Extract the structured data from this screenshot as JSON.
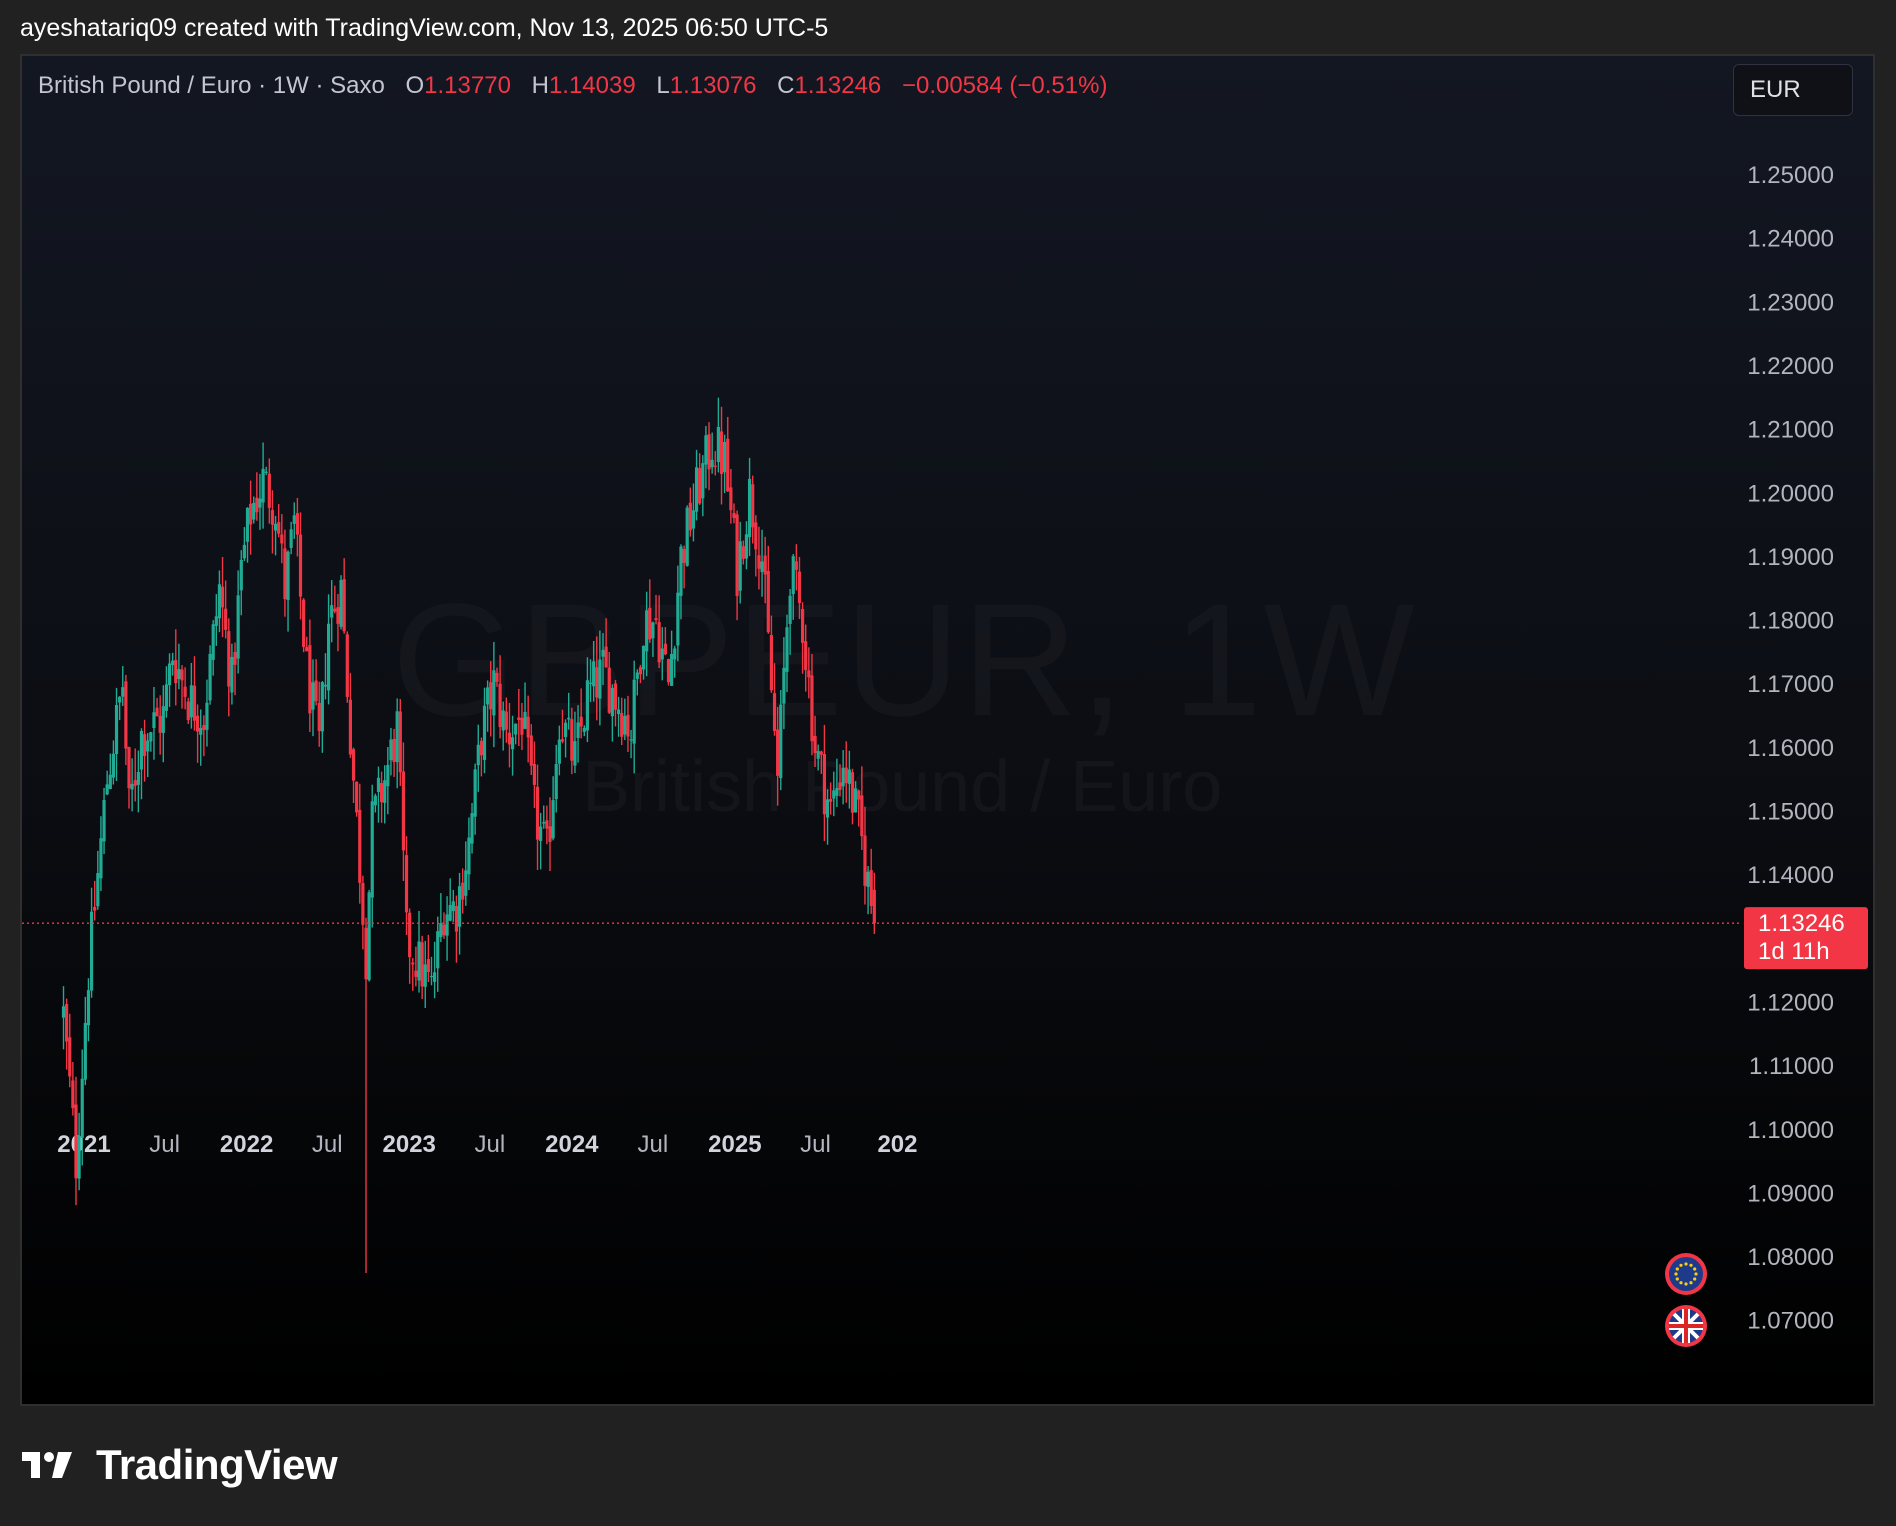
{
  "caption": "ayeshatariq09 created with TradingView.com, Nov 13, 2025 06:50 UTC-5",
  "legend": {
    "symbol_name": "British Pound / Euro · 1W · Saxo",
    "open_label": "O",
    "open_value": "1.13770",
    "high_label": "H",
    "high_value": "1.14039",
    "low_label": "L",
    "low_value": "1.13076",
    "close_label": "C",
    "close_value": "1.13246",
    "change": "−0.00584 (−0.51%)"
  },
  "currency_button": "EUR",
  "watermark": {
    "ticker": "GBPEUR, 1W",
    "description": "British Pound / Euro"
  },
  "brand": "TradingView",
  "colors": {
    "up": "#22ab94",
    "down": "#f23645",
    "axis_text": "#b2b5be",
    "price_line": "#f23645"
  },
  "icons": [
    "eu-flag-icon",
    "uk-flag-icon",
    "tradingview-logo-icon"
  ],
  "chart_data": {
    "type": "candlestick",
    "symbol": "GBPEUR",
    "timeframe": "1W",
    "ylim": [
      1.065,
      1.262
    ],
    "y_ticks": [
      "1.25000",
      "1.24000",
      "1.23000",
      "1.22000",
      "1.21000",
      "1.20000",
      "1.19000",
      "1.18000",
      "1.17000",
      "1.16000",
      "1.15000",
      "1.14000",
      "1.13000",
      "1.12000",
      "1.11000",
      "1.10000",
      "1.09000",
      "1.08000",
      "1.07000"
    ],
    "x_ticks": [
      {
        "label": "2021",
        "date": "2021-01-01",
        "bold": true
      },
      {
        "label": "Jul",
        "date": "2021-07-01",
        "bold": false
      },
      {
        "label": "2022",
        "date": "2022-01-01",
        "bold": true
      },
      {
        "label": "Jul",
        "date": "2022-07-01",
        "bold": false
      },
      {
        "label": "2023",
        "date": "2023-01-01",
        "bold": true
      },
      {
        "label": "Jul",
        "date": "2023-07-01",
        "bold": false
      },
      {
        "label": "2024",
        "date": "2024-01-01",
        "bold": true
      },
      {
        "label": "Jul",
        "date": "2024-07-01",
        "bold": false
      },
      {
        "label": "2025",
        "date": "2025-01-01",
        "bold": true
      },
      {
        "label": "Jul",
        "date": "2025-07-01",
        "bold": false
      },
      {
        "label": "202",
        "date": "2026-01-01",
        "bold": true
      }
    ],
    "last_price": {
      "value": 1.13246,
      "label": "1.13246",
      "countdown": "1d 11h"
    },
    "close_path": [
      [
        "2020-11-16",
        1.118
      ],
      [
        "2020-12-14",
        1.095
      ],
      [
        "2021-01-11",
        1.125
      ],
      [
        "2021-02-22",
        1.155
      ],
      [
        "2021-03-29",
        1.17
      ],
      [
        "2021-04-12",
        1.15
      ],
      [
        "2021-05-10",
        1.162
      ],
      [
        "2021-06-28",
        1.165
      ],
      [
        "2021-07-19",
        1.175
      ],
      [
        "2021-08-23",
        1.168
      ],
      [
        "2021-09-27",
        1.165
      ],
      [
        "2021-11-01",
        1.185
      ],
      [
        "2021-11-29",
        1.17
      ],
      [
        "2021-12-20",
        1.188
      ],
      [
        "2022-01-10",
        1.197
      ],
      [
        "2022-02-07",
        1.202
      ],
      [
        "2022-03-07",
        1.198
      ],
      [
        "2022-03-28",
        1.185
      ],
      [
        "2022-04-18",
        1.195
      ],
      [
        "2022-05-16",
        1.172
      ],
      [
        "2022-06-13",
        1.16
      ],
      [
        "2022-07-04",
        1.18
      ],
      [
        "2022-08-01",
        1.185
      ],
      [
        "2022-08-29",
        1.155
      ],
      [
        "2022-09-26",
        1.128
      ],
      [
        "2022-10-10",
        1.148
      ],
      [
        "2022-11-07",
        1.155
      ],
      [
        "2022-12-05",
        1.163
      ],
      [
        "2022-12-26",
        1.13
      ],
      [
        "2023-01-23",
        1.126
      ],
      [
        "2023-02-20",
        1.122
      ],
      [
        "2023-03-20",
        1.135
      ],
      [
        "2023-04-17",
        1.135
      ],
      [
        "2023-05-15",
        1.145
      ],
      [
        "2023-06-12",
        1.162
      ],
      [
        "2023-07-10",
        1.17
      ],
      [
        "2023-08-07",
        1.162
      ],
      [
        "2023-09-11",
        1.165
      ],
      [
        "2023-10-09",
        1.15
      ],
      [
        "2023-11-06",
        1.143
      ],
      [
        "2023-12-04",
        1.165
      ],
      [
        "2024-01-08",
        1.158
      ],
      [
        "2024-02-05",
        1.168
      ],
      [
        "2024-03-11",
        1.172
      ],
      [
        "2024-04-08",
        1.168
      ],
      [
        "2024-05-13",
        1.163
      ],
      [
        "2024-06-10",
        1.18
      ],
      [
        "2024-07-08",
        1.18
      ],
      [
        "2024-08-05",
        1.17
      ],
      [
        "2024-09-02",
        1.19
      ],
      [
        "2024-10-07",
        1.2
      ],
      [
        "2024-11-11",
        1.208
      ],
      [
        "2024-12-09",
        1.205
      ],
      [
        "2025-01-06",
        1.188
      ],
      [
        "2025-02-03",
        1.2
      ],
      [
        "2025-03-03",
        1.19
      ],
      [
        "2025-04-07",
        1.155
      ],
      [
        "2025-05-05",
        1.188
      ],
      [
        "2025-06-02",
        1.18
      ],
      [
        "2025-06-30",
        1.16
      ],
      [
        "2025-08-04",
        1.15
      ],
      [
        "2025-09-01",
        1.158
      ],
      [
        "2025-10-06",
        1.148
      ],
      [
        "2025-11-10",
        1.13246
      ]
    ]
  }
}
